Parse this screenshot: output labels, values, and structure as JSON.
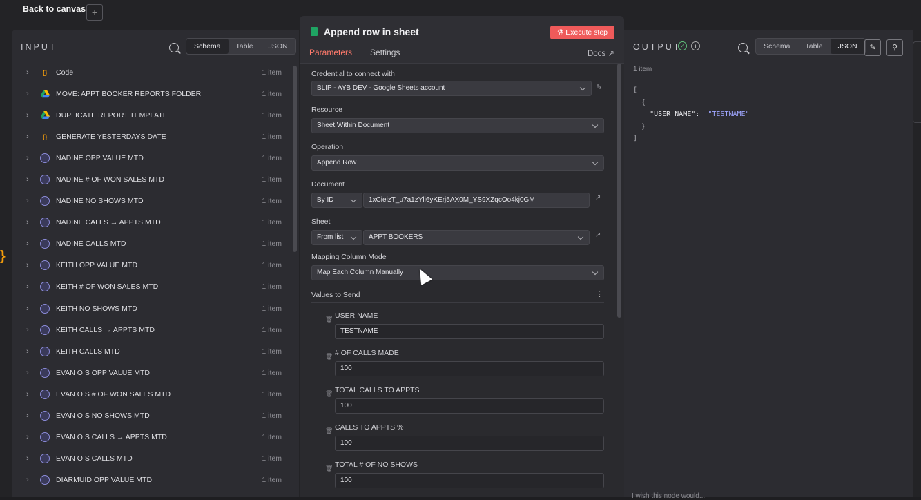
{
  "top": {
    "back_label": "Back to canvas"
  },
  "input": {
    "title": "INPUT",
    "views": [
      "Schema",
      "Table",
      "JSON"
    ],
    "rows": [
      {
        "icon": "code",
        "name": "Code",
        "count": "1 item"
      },
      {
        "icon": "drive",
        "name": "MOVE: APPT BOOKER REPORTS FOLDER",
        "count": "1 item"
      },
      {
        "icon": "drive",
        "name": "DUPLICATE REPORT TEMPLATE",
        "count": "1 item"
      },
      {
        "icon": "code",
        "name": "GENERATE YESTERDAYS DATE",
        "count": "1 item"
      },
      {
        "icon": "globe",
        "name": "NADINE OPP VALUE MTD",
        "count": "1 item"
      },
      {
        "icon": "globe",
        "name": "NADINE # OF WON SALES MTD",
        "count": "1 item"
      },
      {
        "icon": "globe",
        "name": "NADINE NO SHOWS MTD",
        "count": "1 item"
      },
      {
        "icon": "globe",
        "name": "NADINE CALLS → APPTS MTD",
        "count": "1 item"
      },
      {
        "icon": "globe",
        "name": "NADINE CALLS MTD",
        "count": "1 item"
      },
      {
        "icon": "globe",
        "name": "KEITH OPP VALUE MTD",
        "count": "1 item"
      },
      {
        "icon": "globe",
        "name": "KEITH # OF WON SALES MTD",
        "count": "1 item"
      },
      {
        "icon": "globe",
        "name": "KEITH NO SHOWS MTD",
        "count": "1 item"
      },
      {
        "icon": "globe",
        "name": "KEITH CALLS → APPTS MTD",
        "count": "1 item"
      },
      {
        "icon": "globe",
        "name": "KEITH CALLS MTD",
        "count": "1 item"
      },
      {
        "icon": "globe",
        "name": "EVAN O S OPP VALUE MTD",
        "count": "1 item"
      },
      {
        "icon": "globe",
        "name": "EVAN O S # OF WON SALES MTD",
        "count": "1 item"
      },
      {
        "icon": "globe",
        "name": "EVAN O S NO SHOWS MTD",
        "count": "1 item"
      },
      {
        "icon": "globe",
        "name": "EVAN O S CALLS → APPTS MTD",
        "count": "1 item"
      },
      {
        "icon": "globe",
        "name": "EVAN O S CALLS MTD",
        "count": "1 item"
      },
      {
        "icon": "globe",
        "name": "DIARMUID OPP VALUE MTD",
        "count": "1 item"
      }
    ]
  },
  "node": {
    "title": "Append row in sheet",
    "execute_label": "Execute step",
    "tabs": [
      "Parameters",
      "Settings"
    ],
    "docs_label": "Docs",
    "credential_label": "Credential to connect with",
    "credential_value": "BLIP - AYB DEV - Google Sheets account",
    "resource_label": "Resource",
    "resource_value": "Sheet Within Document",
    "operation_label": "Operation",
    "operation_value": "Append Row",
    "document_label": "Document",
    "document_mode": "By ID",
    "document_value": "1xCieizT_u7a1zYli6yKErj5AX0M_YS9XZqcOo4kj0GM",
    "sheet_label": "Sheet",
    "sheet_mode": "From list",
    "sheet_value": "APPT BOOKERS",
    "mapping_label": "Mapping Column Mode",
    "mapping_value": "Map Each Column Manually",
    "values_label": "Values to Send",
    "values": [
      {
        "name": "USER NAME",
        "value": "TESTNAME"
      },
      {
        "name": "# OF CALLS MADE",
        "value": "100"
      },
      {
        "name": "TOTAL CALLS TO APPTS",
        "value": "100"
      },
      {
        "name": "CALLS TO APPTS %",
        "value": "100"
      },
      {
        "name": "TOTAL # OF NO SHOWS",
        "value": "100"
      }
    ]
  },
  "output": {
    "title": "OUTPUT",
    "views": [
      "Schema",
      "Table",
      "JSON"
    ],
    "items_label": "1 item",
    "json_key": "\"USER NAME\":",
    "json_value": "\"TESTNAME\"",
    "bottom_text": "I wish this node would..."
  }
}
